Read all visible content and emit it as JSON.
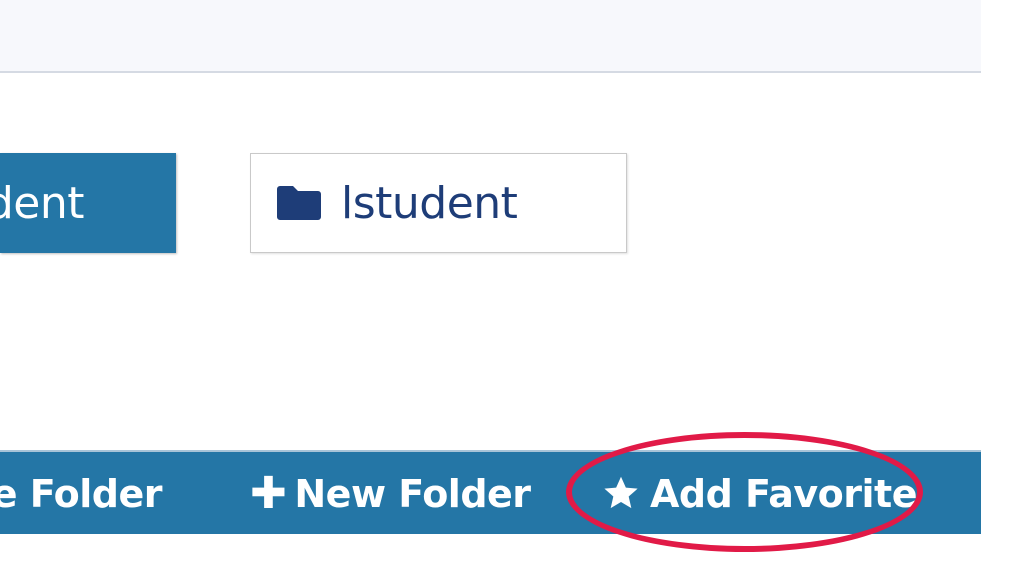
{
  "header": {},
  "folders": [
    {
      "label": "lstudent",
      "visible_text": "dent",
      "selected": true
    },
    {
      "label": "lstudent",
      "selected": false
    }
  ],
  "actions": {
    "rename_folder": "Rename Folder",
    "new_folder": "New Folder",
    "add_favorite": "Add Favorite"
  },
  "icons": {
    "folder": "folder-icon",
    "plus": "plus-icon",
    "star": "star-icon"
  },
  "colors": {
    "accent": "#2476a6",
    "folder_text": "#1e3d78",
    "highlight": "#e11a47",
    "topbar_bg": "#f7f8fc"
  }
}
